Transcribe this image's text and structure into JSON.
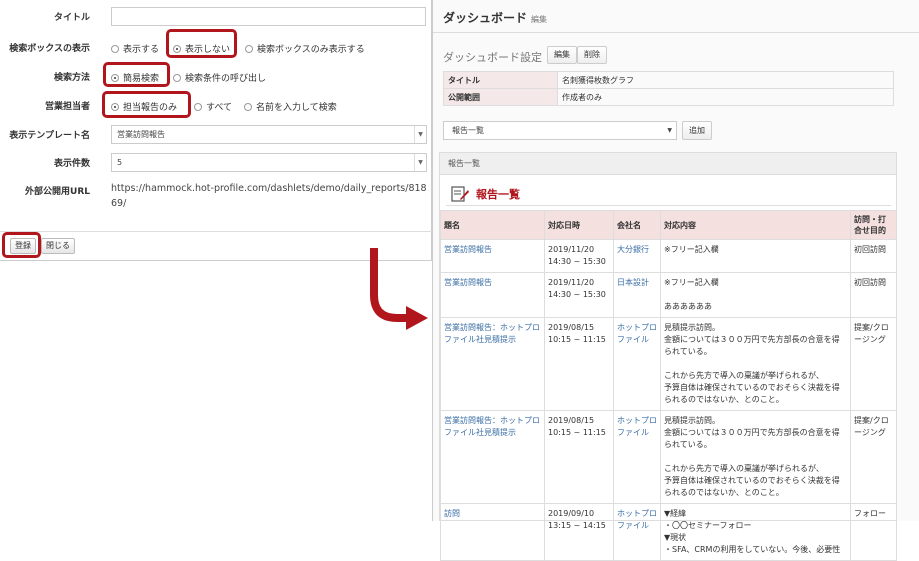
{
  "form": {
    "title_label": "タイトル",
    "title_value": "",
    "searchbox_label": "検索ボックスの表示",
    "searchbox_options": [
      "表示する",
      "表示しない",
      "検索ボックスのみ表示する"
    ],
    "search_method_label": "検索方法",
    "search_method_options": [
      "簡易検索",
      "検索条件の呼び出し"
    ],
    "sales_rep_label": "営業担当者",
    "sales_rep_options": [
      "担当報告のみ",
      "すべて",
      "名前を入力して検索"
    ],
    "template_label": "表示テンプレート名",
    "template_value": "営業訪問報告",
    "count_label": "表示件数",
    "count_value": "5",
    "url_label": "外部公開用URL",
    "url_value": "https://hammock.hot-profile.com/dashlets/demo/daily_reports/81869/",
    "register_label": "登録",
    "close_label": "閉じる"
  },
  "dashboard": {
    "title": "ダッシュボード",
    "edit_link": "編集",
    "settings_label": "ダッシュボード設定",
    "edit_button": "編集",
    "delete_button": "削除",
    "info": [
      {
        "key": "タイトル",
        "value": "名刺獲得枚数グラフ"
      },
      {
        "key": "公開範囲",
        "value": "作成者のみ"
      }
    ],
    "select_value": "報告一覧",
    "add_button": "追加",
    "panel_header": "報告一覧",
    "report_title": "報告一覧",
    "columns": [
      "題名",
      "対応日時",
      "会社名",
      "対応内容",
      "訪問・打合せ目的"
    ],
    "rows": [
      {
        "title": "営業訪問報告",
        "date": "2019/11/20 14:30 ~ 15:30",
        "company": "大分銀行",
        "content": "※フリー記入欄",
        "purpose": "初回訪問"
      },
      {
        "title": "営業訪問報告",
        "date": "2019/11/20 14:30 ~ 15:30",
        "company": "日本設計",
        "content": "※フリー記入欄\n\nああああああ",
        "purpose": "初回訪問"
      },
      {
        "title": "営業訪問報告：ホットプロファイル社見積提示",
        "date": "2019/08/15 10:15 ~ 11:15",
        "company": "ホットプロファイル",
        "content": "見積提示訪問。\n金額については３００万円で先方部長の合意を得られている。\n\nこれから先方で導入の稟議が挙げられるが、\n予算自体は確保されているのでおそらく決裁を得られるのではないか、とのこと。",
        "purpose": "提案/クロージング"
      },
      {
        "title": "営業訪問報告：ホットプロファイル社見積提示",
        "date": "2019/08/15 10:15 ~ 11:15",
        "company": "ホットプロファイル",
        "content": "見積提示訪問。\n金額については３００万円で先方部長の合意を得られている。\n\nこれから先方で導入の稟議が挙げられるが、\n予算自体は確保されているのでおそらく決裁を得られるのではないか、とのこと。",
        "purpose": "提案/クロージング"
      },
      {
        "title": "訪問",
        "date": "2019/09/10 13:15 ~ 14:15",
        "company": "ホットプロファイル",
        "content": "▼経緯\n・〇〇セミナーフォロー\n▼現状\n・SFA、CRMの利用をしていない。今後、必要性",
        "purpose": "フォロー"
      }
    ]
  },
  "colors": {
    "highlight": "#b0161c",
    "link": "#3a6ea5",
    "header_bg": "#f5e0e0"
  }
}
